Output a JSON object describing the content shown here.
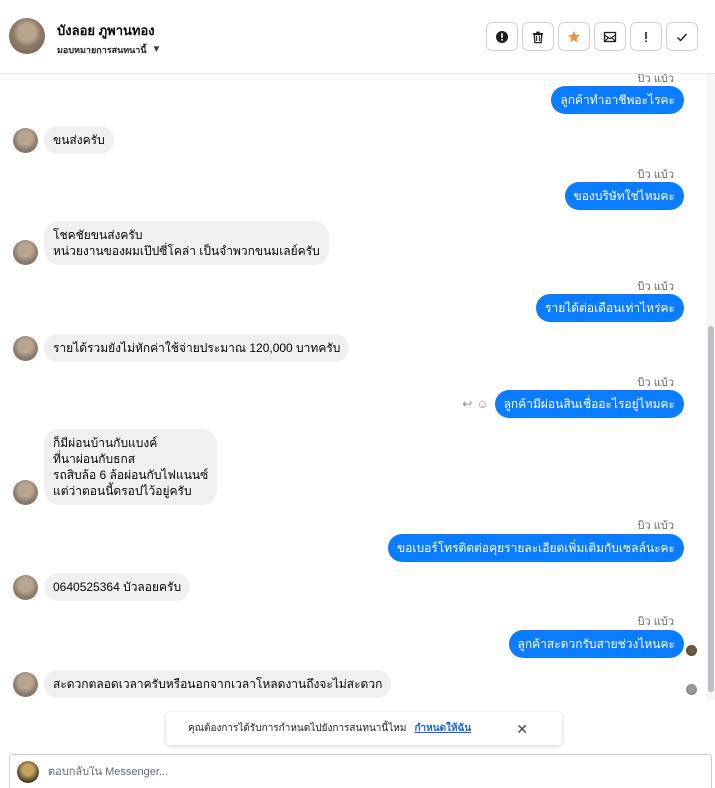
{
  "header": {
    "contact_name": "บังลอย ภูพานทอง",
    "assign_label": "มอบหมายการสนทนานี้",
    "actions": [
      {
        "name": "spam-button",
        "icon": "alert-circle-icon"
      },
      {
        "name": "delete-button",
        "icon": "trash-icon"
      },
      {
        "name": "follow-up-button",
        "icon": "star-icon"
      },
      {
        "name": "mark-unread-button",
        "icon": "envelope-icon"
      },
      {
        "name": "important-button",
        "icon": "exclamation-icon"
      },
      {
        "name": "mark-done-button",
        "icon": "check-icon"
      }
    ]
  },
  "colors": {
    "outgoing_bubble": "#0a7cff",
    "incoming_bubble": "#f0f0f0",
    "star": "#f7923a",
    "link": "#1a66d4"
  },
  "messages": [
    {
      "direction": "out",
      "sender": "บิว แบ้ว",
      "text": "ลูกค้าทำอาชีพอะไรคะ"
    },
    {
      "direction": "in",
      "text": "ขนส่งครับ"
    },
    {
      "direction": "out",
      "sender": "บิว แบ้ว",
      "text": "ของบริษัทใช่ไหมคะ"
    },
    {
      "direction": "in",
      "text": "โชคชัยขนส่งครับ\nหน่วยงานของผมเป๊ปซี่โคล่า เป็นจำพวกขนมเลย์ครับ"
    },
    {
      "direction": "out",
      "sender": "บิว แบ้ว",
      "text": "รายได้ต่อเดือนเท่าไหร่คะ"
    },
    {
      "direction": "in",
      "text": "รายได้รวมยังไม่หักค่าใช้จ่ายประมาณ 120,000 บาทครับ"
    },
    {
      "direction": "out",
      "sender": "บิว แบ้ว",
      "text": "ลูกค้ามีผ่อนสินเชื่ออะไรอยู่ไหมคะ"
    },
    {
      "direction": "in",
      "text": "ก็มีผ่อนบ้านกับแบงค์\nที่นาผ่อนกับธกส\nรถสิบล้อ 6 ล้อผ่อนกับไฟแนนซ์\nแต่ว่าตอนนี้ดรอปไว้อยู่ครับ"
    },
    {
      "direction": "out",
      "sender": "บิว แบ้ว",
      "text": "ขอเบอร์โทรติดต่อคุยรายละเอียดเพิ่มเติมกับเซลล์นะคะ"
    },
    {
      "direction": "in",
      "text": "0640525364 บัวลอยครับ"
    },
    {
      "direction": "out",
      "sender": "บิว แบ้ว",
      "text": "ลูกค้าสะดวกรับสายช่วงไหนคะ"
    },
    {
      "direction": "in",
      "text": "สะดวกตลอดเวลาครับหรือนอกจากเวลาโหลดงานถึงจะไม่สะดวก"
    }
  ],
  "notice": {
    "text": "คุณต้องการได้รับการกำหนดไปยังการสนทนานี้ไหม",
    "link": "กำหนดให้ฉัน",
    "close_icon": "close-icon"
  },
  "composer": {
    "placeholder": "ตอบกลับใน Messenger..."
  }
}
